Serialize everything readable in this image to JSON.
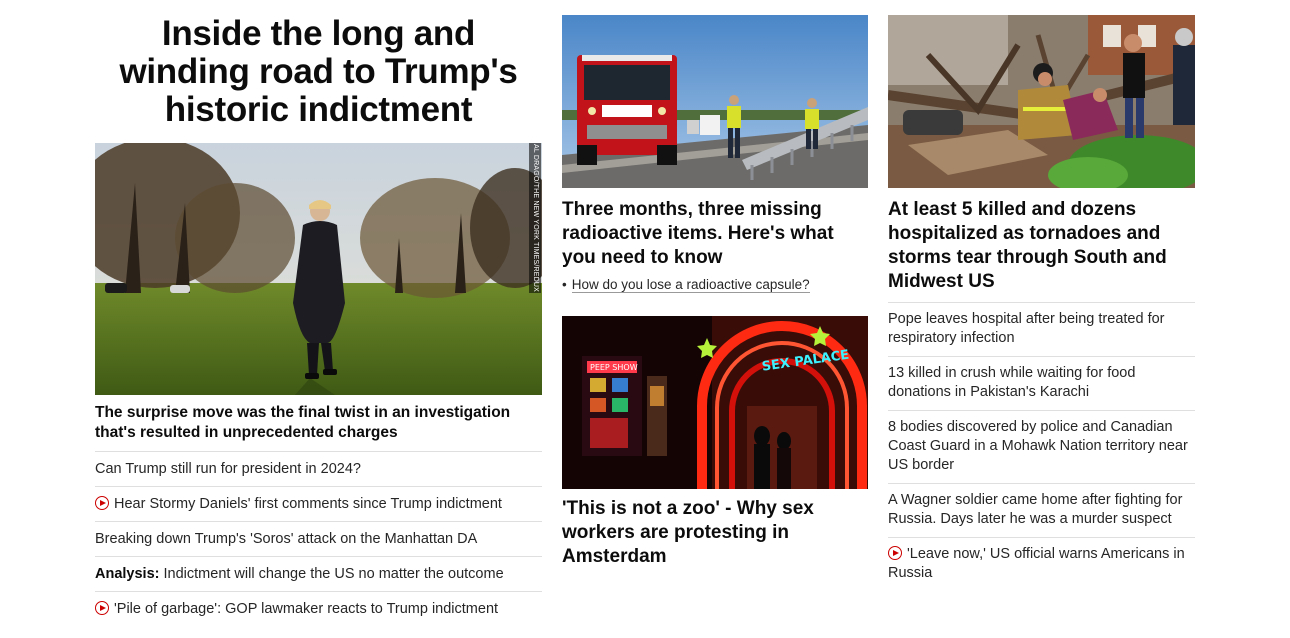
{
  "left": {
    "headline": "Inside the long and winding road to Trump's historic indictment",
    "photo_credit": "AL DRAGO/THE NEW YORK TIMES/REDUX",
    "subheadline": "The surprise move was the final twist in an investigation that's resulted in unprecedented charges",
    "links": [
      {
        "text": "Can Trump still run for president in 2024?",
        "video": false,
        "prefix": ""
      },
      {
        "text": "Hear Stormy Daniels' first comments since Trump indictment",
        "video": true,
        "prefix": ""
      },
      {
        "text": "Breaking down Trump's 'Soros' attack on the Manhattan DA",
        "video": false,
        "prefix": ""
      },
      {
        "text": "Indictment will change the US no matter the outcome",
        "video": false,
        "prefix": "Analysis:"
      },
      {
        "text": "'Pile of garbage': GOP lawmaker reacts to Trump indictment",
        "video": true,
        "prefix": ""
      }
    ]
  },
  "middle": {
    "card1": {
      "title": "Three months, three missing radioactive items. Here's what you need to know",
      "related": "How do you lose a radioactive capsule?",
      "image": "fire-truck-highway-photo"
    },
    "card2": {
      "title": "'This is not a zoo' - Why sex workers are protesting in Amsterdam",
      "image": "red-light-district-photo",
      "sign_text": "SEX PALACE",
      "sign_text_2": "PEEP SHOW"
    }
  },
  "right": {
    "card": {
      "title": "At least 5 killed and dozens hospitalized as tornadoes and storms tear through South and Midwest US",
      "image": "tornado-rescue-photo"
    },
    "links": [
      {
        "text": "Pope leaves hospital after being treated for respiratory infection",
        "video": false
      },
      {
        "text": "13 killed in crush while waiting for food donations in Pakistan's Karachi",
        "video": false
      },
      {
        "text": "8 bodies discovered by police and Canadian Coast Guard in a Mohawk Nation territory near US border",
        "video": false
      },
      {
        "text": "A Wagner soldier came home after fighting for Russia. Days later he was a murder suspect",
        "video": false
      },
      {
        "text": "'Leave now,' US official warns Americans in Russia",
        "video": true
      }
    ]
  },
  "colors": {
    "text": "#0c0c0c",
    "body_text": "#262626",
    "divider": "#dfdfdf",
    "video_icon": "#cc0000"
  }
}
